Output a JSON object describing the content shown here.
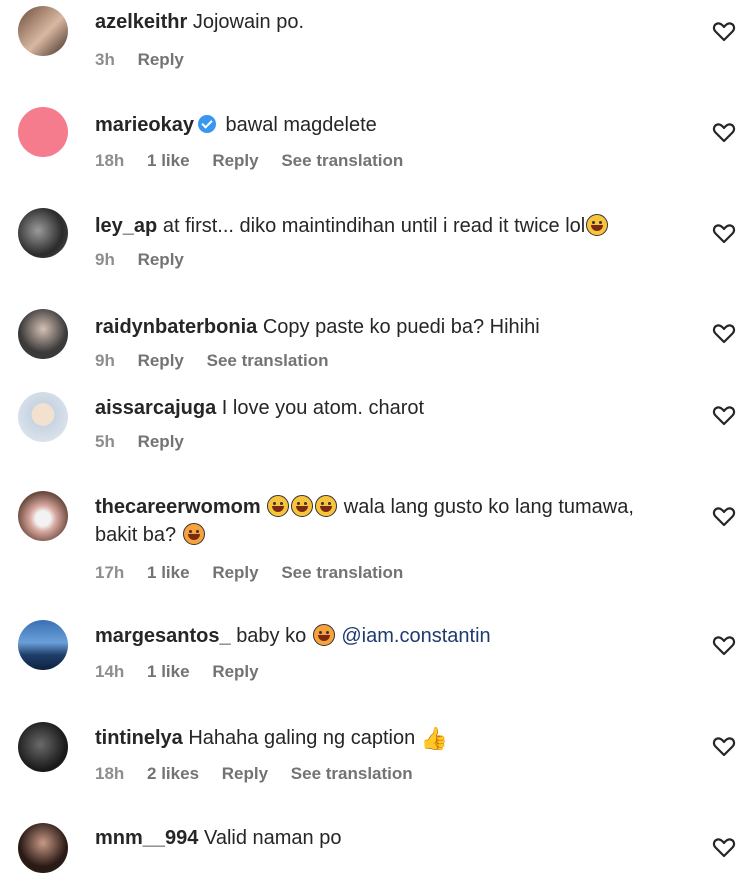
{
  "comments": [
    {
      "username": "azelkeithr",
      "text": "Jojowain po.",
      "time": "3h",
      "likes": "",
      "reply": "Reply",
      "translate": ""
    },
    {
      "username": "marieokay",
      "text": "bawal magdelete",
      "time": "18h",
      "likes": "1 like",
      "reply": "Reply",
      "translate": "See translation"
    },
    {
      "username": "ley_ap",
      "text": "at first... diko maintindihan until i read it twice lol",
      "time": "9h",
      "likes": "",
      "reply": "Reply",
      "translate": ""
    },
    {
      "username": "raidynbaterbonia",
      "text": "Copy paste ko puedi ba? Hihihi",
      "time": "9h",
      "likes": "",
      "reply": "Reply",
      "translate": "See translation"
    },
    {
      "username": "aissarcajuga",
      "text": "I love you atom. charot",
      "time": "5h",
      "likes": "",
      "reply": "Reply",
      "translate": ""
    },
    {
      "username": "thecareerwomom",
      "text_a": "wala lang gusto ko lang tumawa,",
      "text_b": "bakit ba?",
      "time": "17h",
      "likes": "1 like",
      "reply": "Reply",
      "translate": "See translation"
    },
    {
      "username": "margesantos_",
      "text": "baby ko",
      "mention": "@iam.constantin",
      "time": "14h",
      "likes": "1 like",
      "reply": "Reply",
      "translate": ""
    },
    {
      "username": "tintinelya",
      "text": "Hahaha galing ng caption",
      "time": "18h",
      "likes": "2 likes",
      "reply": "Reply",
      "translate": "See translation"
    },
    {
      "username": "mnm__994",
      "text": "Valid naman po"
    }
  ],
  "colors": {
    "text": "#262626",
    "meta": "#737373",
    "verified": "#3897f0",
    "mention": "#1f3a6e"
  },
  "icons": {
    "like": "heart-outline-icon",
    "verified": "verified-badge-icon"
  }
}
